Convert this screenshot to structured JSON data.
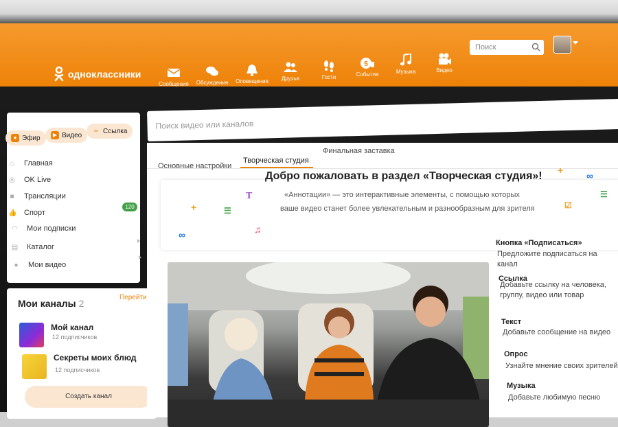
{
  "brand": {
    "name": "одноклассники"
  },
  "colors": {
    "accent": "#ee8208",
    "badge": "#43a047",
    "pill_bg": "#fbe6d2"
  },
  "topnav": {
    "items": [
      {
        "label": "Сообщения",
        "icon": "envelope-icon"
      },
      {
        "label": "Обсуждения",
        "icon": "chat-bubbles-icon"
      },
      {
        "label": "Оповещения",
        "icon": "bell-icon"
      },
      {
        "label": "Друзья",
        "icon": "friends-icon"
      },
      {
        "label": "Гости",
        "icon": "footprints-icon"
      },
      {
        "label": "События",
        "icon": "events-icon"
      },
      {
        "label": "Музыка",
        "icon": "music-note-icon"
      },
      {
        "label": "Видео",
        "icon": "video-camera-icon"
      }
    ],
    "search_placeholder": "Поиск"
  },
  "sidebar": {
    "pills": [
      {
        "label": "Эфир",
        "icon": "live-icon"
      },
      {
        "label": "Видео",
        "icon": "video-icon"
      },
      {
        "label": "Ссылка",
        "icon": "link-icon"
      }
    ],
    "menu": [
      {
        "label": "Главная",
        "icon": "fire-icon"
      },
      {
        "label": "OK Live",
        "icon": "live-circle-icon"
      },
      {
        "label": "Трансляции",
        "icon": "broadcast-icon"
      },
      {
        "label": "Спорт",
        "icon": "thumb-icon",
        "badge": "120"
      },
      {
        "label": "Мои подписки",
        "icon": "rss-icon"
      },
      {
        "label": "Каталог",
        "icon": "catalog-icon"
      },
      {
        "label": "Мои видео",
        "icon": "user-icon"
      }
    ]
  },
  "channels": {
    "title": "Мои каналы",
    "count": "2",
    "go_link": "Перейти",
    "items": [
      {
        "name": "Мой канал",
        "subs": "12 подписчиков"
      },
      {
        "name": "Секреты моих блюд",
        "subs": "12 подписчиков"
      }
    ],
    "create_button": "Создать канал"
  },
  "main": {
    "search_placeholder": "Поиск видео или каналов",
    "tabs": [
      "Основные настройки",
      "Творческая студия",
      "Финальная заставка"
    ],
    "active_tab": "Творческая студия",
    "welcome": {
      "title": "Добро пожаловать в раздел «Творческая студия»!",
      "line1": "«Аннотации» — это интерактивные элементы, с помощью которых",
      "line2": "ваше видео станет более увлекательным и разнообразным для зрителя"
    },
    "annotations": [
      {
        "title": "Кнопка «Подписаться»",
        "desc": "Предложите подписаться на канал"
      },
      {
        "title": "Ссылка",
        "desc": "Добавьте ссылку на человека, группу, видео или товар"
      },
      {
        "title": "Текст",
        "desc": "Добавьте сообщение на видео"
      },
      {
        "title": "Опрос",
        "desc": "Узнайте мнение своих зрителей"
      },
      {
        "title": "Музыка",
        "desc": "Добавьте любимую песню"
      }
    ]
  }
}
